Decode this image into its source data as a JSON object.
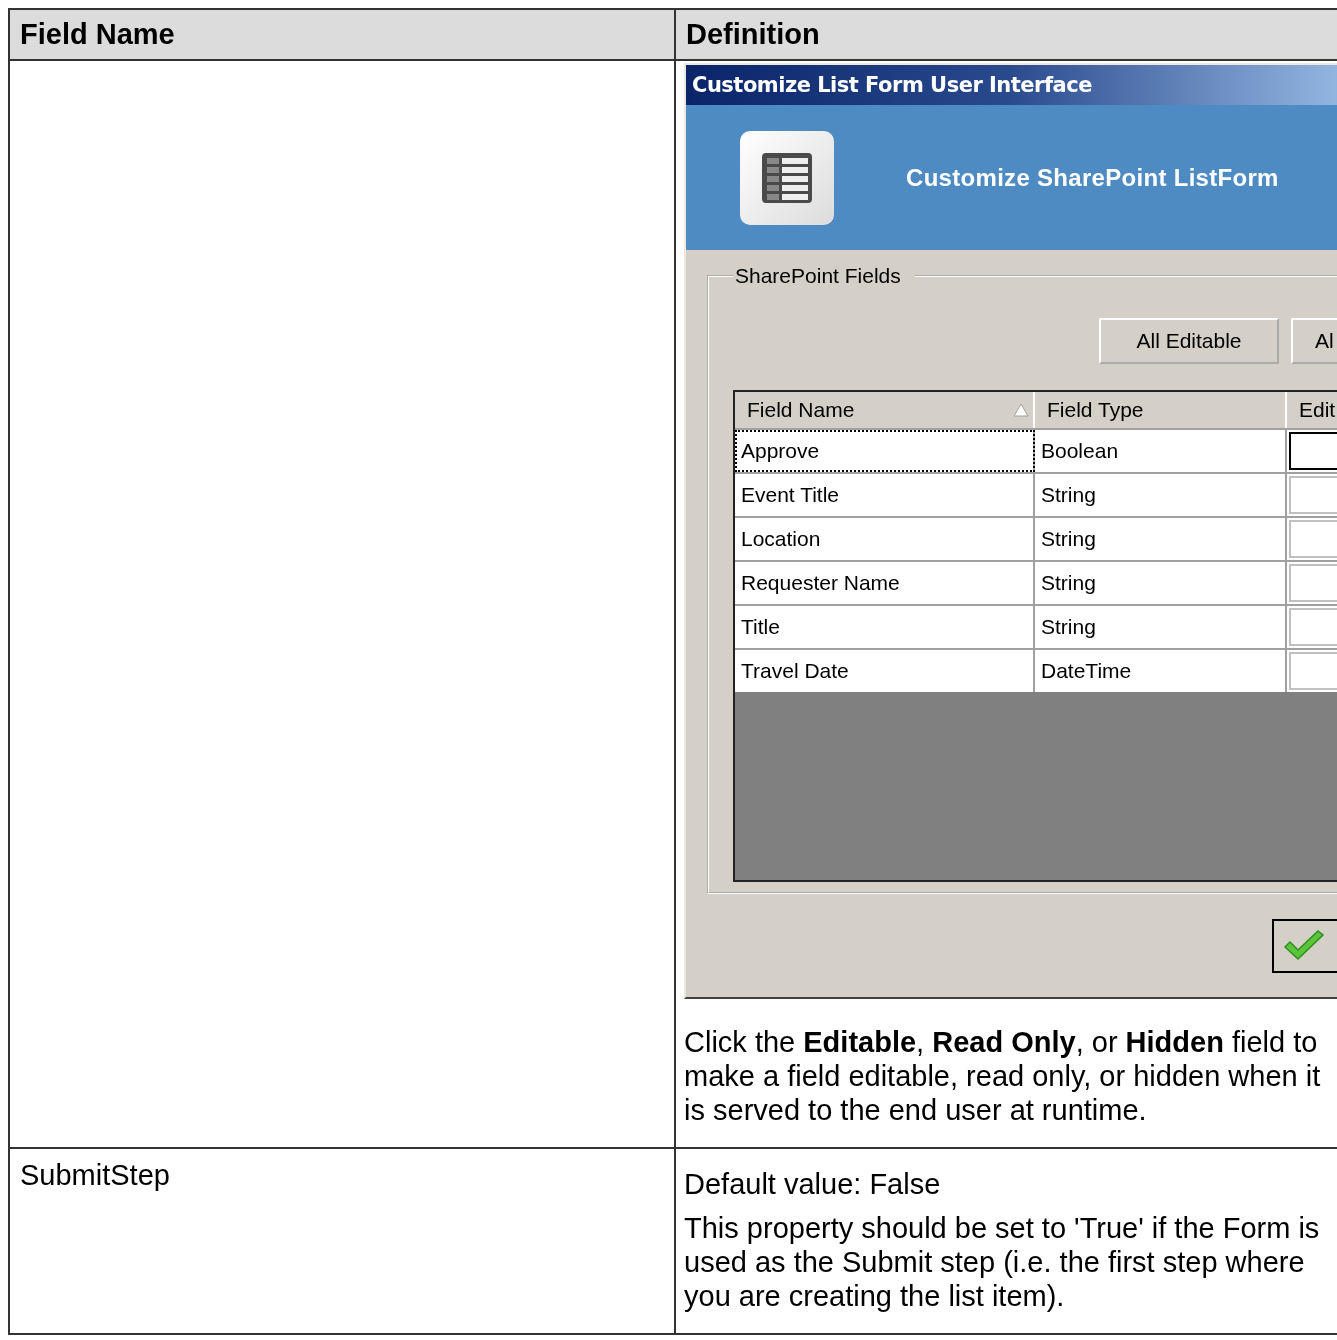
{
  "table": {
    "columns": [
      "Field Name",
      "Definition"
    ],
    "rows": [
      {
        "definition": {
          "dialog": {
            "title": "Customize List Form User Interface",
            "banner_title": "Customize SharePoint ListForm",
            "group_label": "SharePoint Fields",
            "buttons": [
              "All Editable",
              "Al"
            ],
            "grid": {
              "columns": [
                {
                  "label": "Field Name",
                  "sorted": true
                },
                {
                  "label": "Field Type",
                  "sorted": false
                },
                {
                  "label": "Edit",
                  "sorted": false
                }
              ],
              "rows": [
                {
                  "name": "Approve",
                  "type": "Boolean",
                  "editable": true,
                  "selected": true
                },
                {
                  "name": "Event Title",
                  "type": "String",
                  "editable": false,
                  "selected": false
                },
                {
                  "name": "Location",
                  "type": "String",
                  "editable": false,
                  "selected": false
                },
                {
                  "name": "Requester Name",
                  "type": "String",
                  "editable": false,
                  "selected": false
                },
                {
                  "name": "Title",
                  "type": "String",
                  "editable": false,
                  "selected": false
                },
                {
                  "name": "Travel Date",
                  "type": "DateTime",
                  "editable": false,
                  "selected": false
                }
              ]
            }
          },
          "paragraphs": [
            "Click the **Editable**, **Read Only**, or **Hidden** field to make a field editable, read only, or hidden when it is served to the end user at runtime."
          ]
        }
      },
      {
        "field_name": "SubmitStep",
        "definition": {
          "paragraphs": [
            "Default value: False",
            "This property should be set to 'True' if the Form is used as the Submit step (i.e. the first step where you are creating the list item)."
          ]
        }
      }
    ]
  }
}
